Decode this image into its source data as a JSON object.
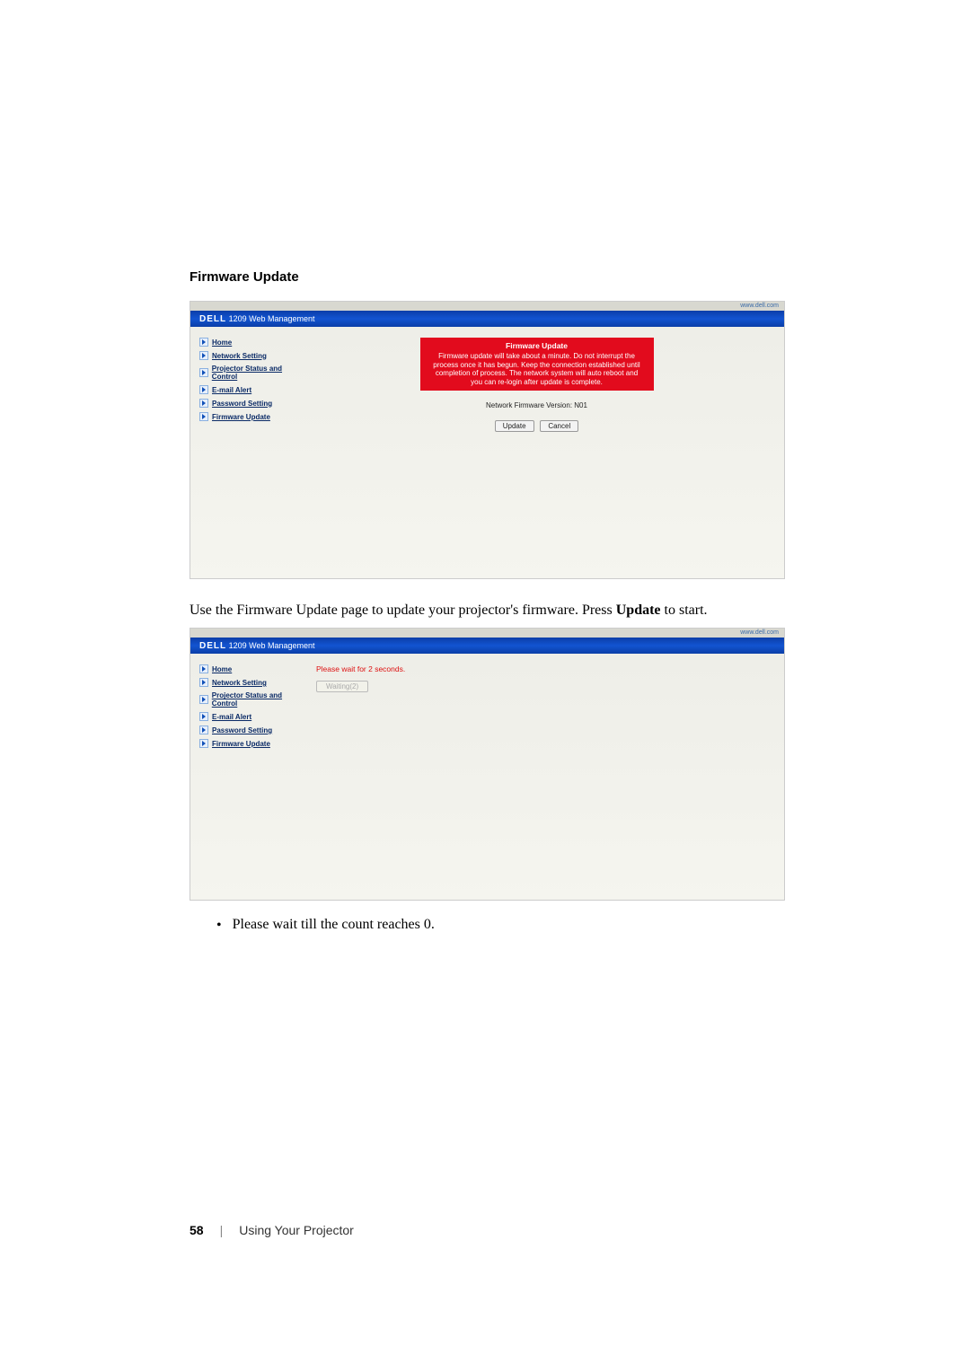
{
  "sectionTitle": "Firmware Update",
  "url_hint": "www.dell.com",
  "header": {
    "brand": "DELL",
    "product": "1209 Web Management"
  },
  "nav": [
    {
      "label": "Home"
    },
    {
      "label": "Network Setting"
    },
    {
      "label": "Projector Status and Control"
    },
    {
      "label": "E-mail Alert"
    },
    {
      "label": "Password Setting"
    },
    {
      "label": "Firmware Update"
    }
  ],
  "panel1": {
    "warningTitle": "Firmware Update",
    "warningBody": "Firmware update will take about a minute. Do not interrupt the process once it has begun. Keep the connection established until completion of process. The network system will auto reboot and you can re-login after update is complete.",
    "fwVersionLabel": "Network Firmware Version: N01",
    "updateBtn": "Update",
    "cancelBtn": "Cancel"
  },
  "para1_pre": "Use the Firmware Update page to update your projector's firmware. Press ",
  "para1_bold": "Update",
  "para1_post": " to start.",
  "panel2": {
    "waitText": "Please wait for 2 seconds.",
    "waitingBtn": "Waiting(2)"
  },
  "bullet1": "Please wait till the count reaches 0.",
  "footer": {
    "page": "58",
    "section": "Using Your Projector"
  }
}
